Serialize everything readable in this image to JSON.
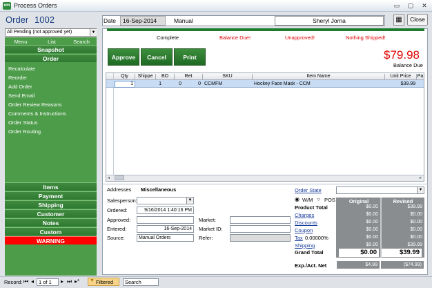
{
  "window": {
    "title": "Process Orders",
    "min_glyph": "▭",
    "max_glyph": "▢",
    "close_glyph": "✕",
    "app_icon": "om"
  },
  "header": {
    "order_label": "Order",
    "order_number": "1002",
    "date_label": "Date",
    "date_value": "16-Sep-2014",
    "mode_value": "Manual",
    "user_value": "Sheryl Jorna",
    "close_label": "Close"
  },
  "filter": {
    "value": "All Pending (not approved yet)"
  },
  "left_tabs": [
    "Menu",
    "List",
    "Search"
  ],
  "left_sections": {
    "snapshot": "Snapshot",
    "order": "Order"
  },
  "order_menu": [
    "Recalculate",
    "Reorder",
    "Add Order",
    "Send Email",
    "Order Review Reasons",
    "Comments & Instructions",
    "Order Status",
    "Order Routing"
  ],
  "bottom_sections": [
    "Items",
    "Payment",
    "Shipping",
    "Customer",
    "Notes",
    "Custom"
  ],
  "warning_label": "WARNING",
  "stages": {
    "complete": "Complete",
    "balance_due": "Balance Due!",
    "unapproved": "Unapproved!",
    "nothing_shipped": "Nothing Shipped!"
  },
  "actions": {
    "approve": "Approve",
    "cancel": "Cancel",
    "print": "Print"
  },
  "balance": {
    "amount": "$79.98",
    "label": "Balance Due"
  },
  "grid": {
    "columns": [
      "Qty",
      "Shippe",
      "BO",
      "Ret",
      "SKU",
      "Item Name",
      "Unit Price",
      "Pa"
    ],
    "row": {
      "qty": "1",
      "shipped": "1",
      "bo": "0",
      "ret": "0",
      "sku": "CCMFM",
      "item_name": "Hockey Face Mask - CCM",
      "unit_price": "$39.99"
    }
  },
  "lower": {
    "addresses": "Addresses",
    "misc": "Miscellaneous",
    "salesperson_label": "Salesperson:",
    "ordered_label": "Ordered:",
    "ordered_value": "9/16/2014 1:40:16 PM",
    "approved_label": "Approved:",
    "entered_label": "Entered:",
    "entered_value": "16-Sep-2014",
    "source_label": "Source:",
    "source_value": "Manual Orders",
    "market_label": "Market:",
    "market_id_label": "Market ID:",
    "refer_label": "Refer:"
  },
  "totals": {
    "order_state": "Order State",
    "wm": "W/M",
    "pos": "POS",
    "original_head": "Original",
    "revised_head": "Revised",
    "product_total": "Product Total",
    "charges": "Charges",
    "discounts": "Discounts",
    "coupon": "Coupon",
    "tax": "Tax",
    "tax_rate": "0.00000%",
    "shipping": "Shipping",
    "grand_total": "Grand Total",
    "exp_act": "Exp./Act. Net",
    "original": [
      "$0.00",
      "$0.00",
      "$0.00",
      "$0.00",
      "$0.00",
      "$0.00"
    ],
    "revised": [
      "$39.99",
      "$0.00",
      "$0.00",
      "$0.00",
      "$0.00",
      "$39.99"
    ],
    "grand_original": "$0.00",
    "grand_revised": "$39.99",
    "exp_original": "$4.99",
    "exp_revised": "($74.99)"
  },
  "status": {
    "record_label": "Record:",
    "record_value": "1 of 1",
    "filtered": "Filtered",
    "search": "Search"
  }
}
